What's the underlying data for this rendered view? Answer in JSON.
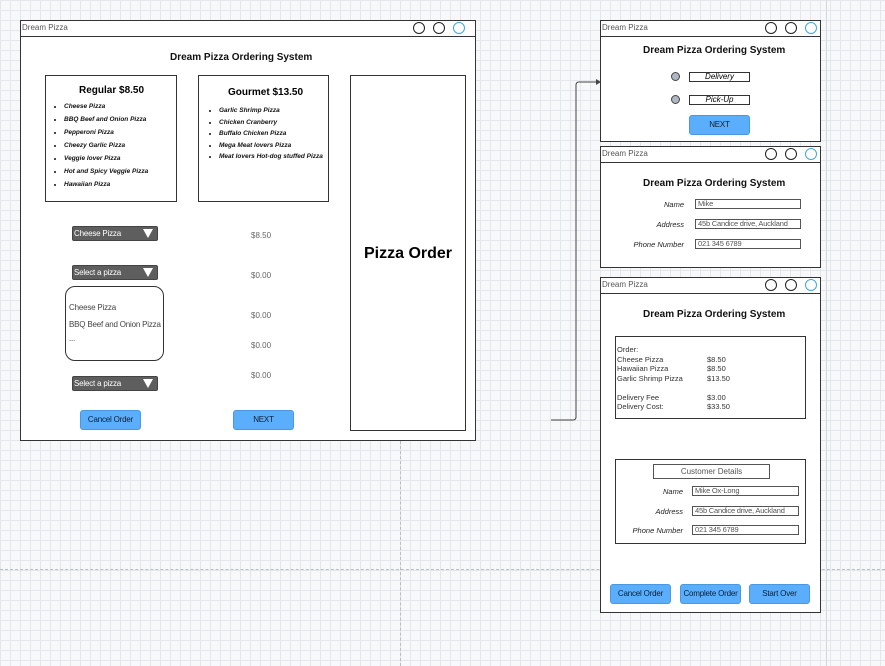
{
  "app_name": "Dream Pizza",
  "system_title": "Dream Pizza Ordering System",
  "main_window": {
    "regular": {
      "title": "Regular $8.50",
      "items": [
        "Cheese Pizza",
        "BBQ Beef and Onion Pizza",
        "Pepperoni Pizza",
        "Cheezy Garlic Pizza",
        "Veggie lover Pizza",
        "Hot and Spicy Veggie Pizza",
        "Hawaiian Pizza"
      ]
    },
    "gourmet": {
      "title": "Gourmet $13.50",
      "items": [
        "Garlic Shrimp Pizza",
        "Chicken Cranberry",
        "Buffalo Chicken Pizza",
        "Mega Meat lovers Pizza",
        "Meat lovers Hot-dog stuffed Pizza"
      ]
    },
    "select1": "Cheese Pizza",
    "select2": "Select a pizza",
    "select3": "Select a pizza",
    "dropdown_options": [
      "Cheese Pizza",
      "BBQ Beef and Onion Pizza",
      "..."
    ],
    "prices": [
      "$8.50",
      "$0.00",
      "$0.00",
      "$0.00",
      "$0.00"
    ],
    "order_panel_title": "Pizza Order",
    "cancel_label": "Cancel Order",
    "next_label": "NEXT"
  },
  "delivery_window": {
    "options": [
      "Delivery",
      "Pick-Up"
    ],
    "next_label": "NEXT"
  },
  "details_window": {
    "labels": [
      "Name",
      "Address",
      "Phone Number"
    ],
    "values": [
      "Mike",
      "45b Candice drive, Auckland",
      "021 345 6789"
    ]
  },
  "summary_window": {
    "order_label": "Order:",
    "items": [
      {
        "name": "Cheese Pizza",
        "price": "$8.50"
      },
      {
        "name": "Hawaiian Pizza",
        "price": "$8.50"
      },
      {
        "name": "Garlic Shrimp Pizza",
        "price": "$13.50"
      }
    ],
    "fees": [
      {
        "name": "Delivery Fee",
        "price": "$3.00"
      },
      {
        "name": "Delivery Cost:",
        "price": "$33.50"
      }
    ],
    "customer_title": "Customer Details",
    "labels": [
      "Name",
      "Address",
      "Phone Number"
    ],
    "values": [
      "Mike Ox-Long",
      "45b Candice drive, Auckland",
      "021 345 6789"
    ],
    "cancel_label": "Cancel Order",
    "complete_label": "Complete Order",
    "startover_label": "Start Over"
  },
  "colors": {
    "button": "#5aaefc",
    "select": "#5e5e5e",
    "radio": "#aeb7c2"
  }
}
